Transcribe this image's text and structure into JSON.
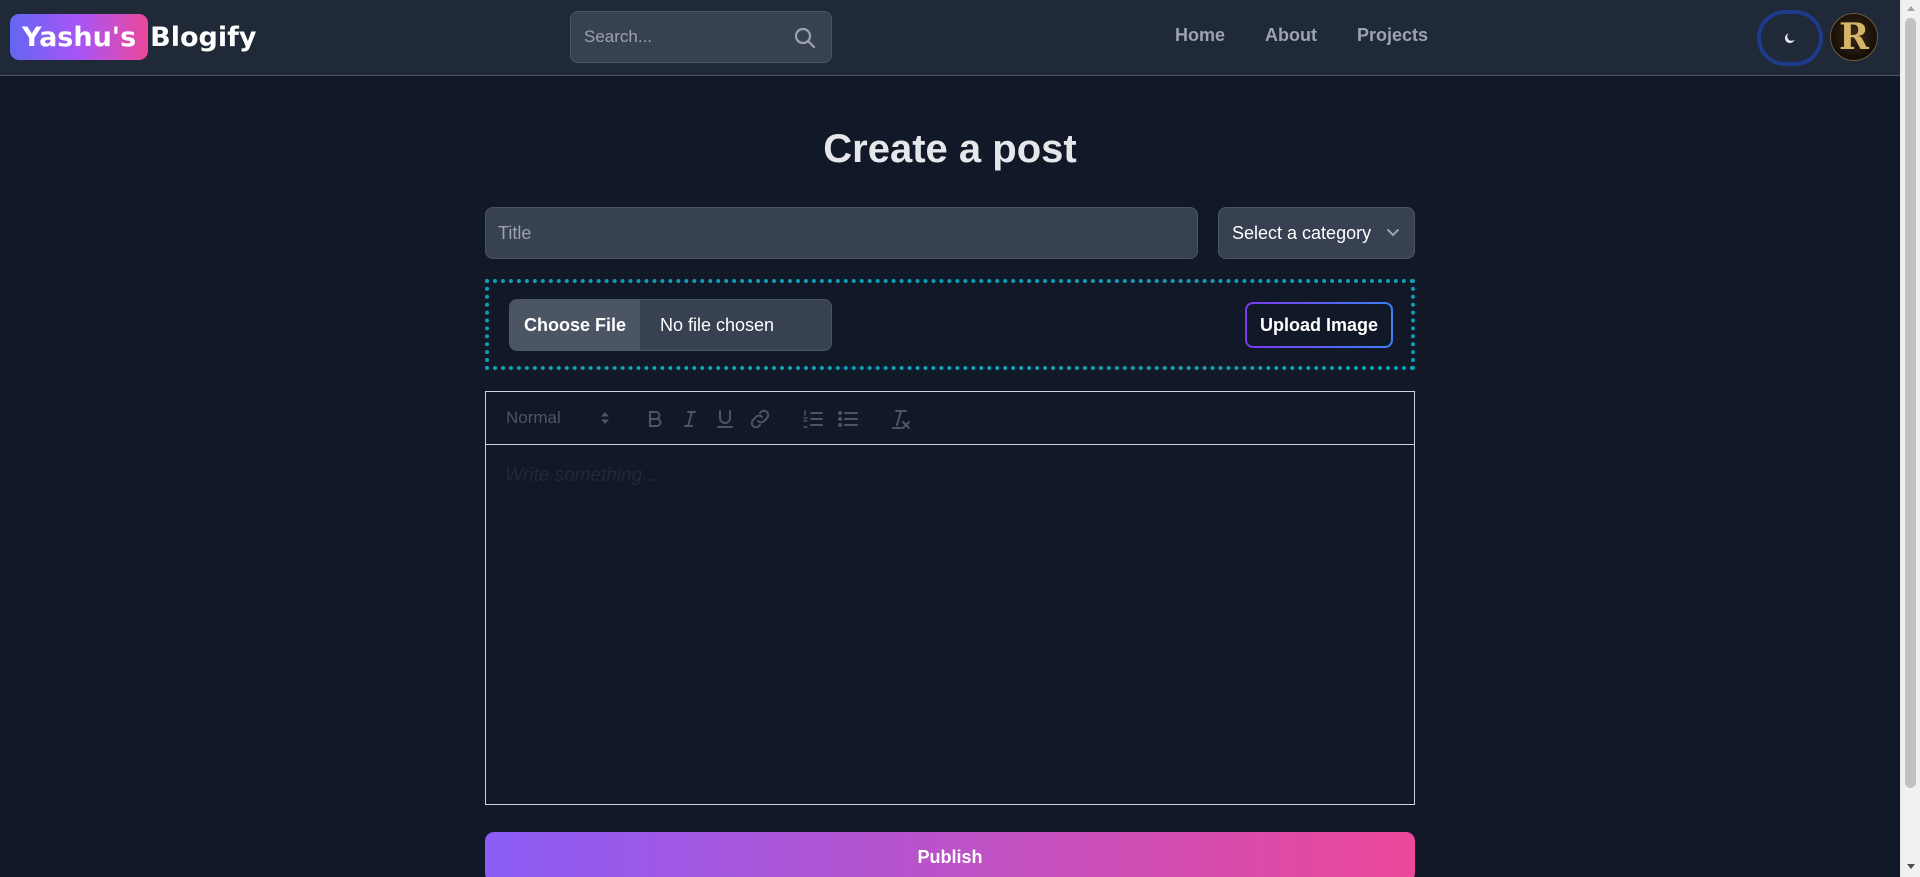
{
  "header": {
    "logo_badge": "Yashu's",
    "logo_text": "Blogify",
    "search_placeholder": "Search...",
    "nav": [
      "Home",
      "About",
      "Projects"
    ],
    "avatar_letter": "R",
    "theme_icon": "moon-icon"
  },
  "main": {
    "title": "Create a post",
    "title_placeholder": "Title",
    "category_selected": "Select a category",
    "choose_file_label": "Choose File",
    "no_file_label": "No file chosen",
    "upload_label": "Upload Image",
    "editor": {
      "format_value": "Normal",
      "toolbar_icons": [
        "bold-icon",
        "italic-icon",
        "underline-icon",
        "link-icon",
        "ordered-list-icon",
        "bullet-list-icon",
        "clear-format-icon"
      ],
      "placeholder": "Write something..."
    },
    "publish_label": "Publish"
  },
  "colors": {
    "background": "#111827",
    "navbar": "#1f2937",
    "accent_gradient_start": "#8b5cf6",
    "accent_gradient_end": "#ec4899",
    "dotted_border": "#0e9fb4"
  }
}
